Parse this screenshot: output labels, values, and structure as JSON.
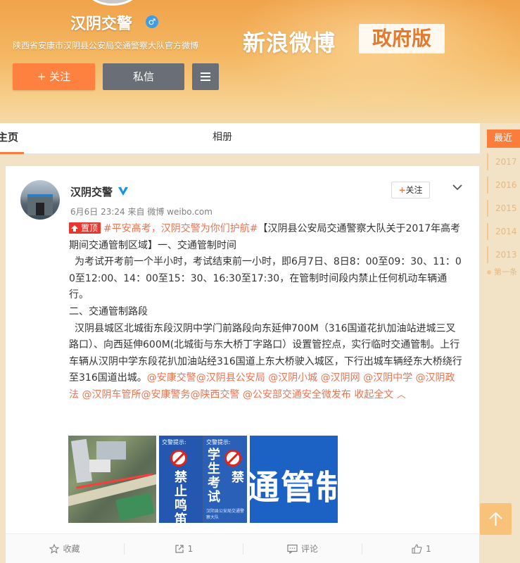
{
  "profile": {
    "name": "汉阴交警",
    "gender_symbol": "♂",
    "description": "陕西省安康市汉阴县公安局交通警察大队官方微博",
    "brand": "新浪微博",
    "brand_badge": "政府版",
    "follow_label": "+ 关注",
    "message_label": "私信"
  },
  "tabs": {
    "home": "主页",
    "album": "相册"
  },
  "timeline": {
    "current": "最近",
    "years": [
      "2017",
      "2016",
      "2015",
      "2014",
      "2013"
    ],
    "first": "第一条"
  },
  "post": {
    "author": "汉阴交警",
    "time": "6月6日 23:24",
    "source_prefix": "来自",
    "source": "微博 weibo.com",
    "follow_label": "关注",
    "pin_label": "置顶",
    "topic": "#平安高考，汉阴交警为你们护航#",
    "para1": "【汉阴县公安局交通警察大队关于2017年高考期间交通管制区域】一、交通管制时间",
    "para2": "为考试开考前一个半小时，考试结束前一小时，即6月7日、8日8：00至09：30、11：00至12:00、14：00至15：30、16:30至17:30，在管制时间段内禁止任何机动车辆通行。",
    "para3": "二、交通管制路段",
    "para4": "汉阴县城区北城街东段汉阴中学门前路段向东延伸700M（316国道花扒加油站进城三叉路口）、向西延伸600M(北城街与东大桥丁字路口）设置管控点，实行临时交通管制。上行车辆从汉阴中学东段花扒加油站经316国道上东大桥驶入城区，下行出城车辆经东大桥绕行至316国道出城。",
    "mentions": [
      "@安康交警",
      "@汉阴县公安局",
      "@汉阴小城",
      "@汉阴网",
      "@汉阴中学",
      "@汉阴政法",
      "@汉阴车管所",
      "@安康警务",
      "@陕西交警",
      "@公安部交通安全微发布"
    ],
    "collapse_label": "收起全文"
  },
  "images": {
    "sign_header": "交警提示:",
    "sign1_text": "禁止鸣笛",
    "sign2_text": "学生考试",
    "sign3_text": "禁",
    "sign_footer": "汉阴县公安局交通警察大队",
    "banner_text": "通管制通"
  },
  "actions": {
    "favorite": "收藏",
    "share_count": "1",
    "comment": "评论",
    "like_count": "1"
  },
  "colors": {
    "accent": "#fa7d3c",
    "link": "#eb7350",
    "pin": "#e8372e",
    "verified": "#1a93e6"
  },
  "icons": [
    "gender-male-icon",
    "menu-icon",
    "verified-icon",
    "chevron-down-icon",
    "star-icon",
    "share-icon",
    "comment-icon",
    "thumbs-up-icon",
    "arrow-up-icon"
  ]
}
